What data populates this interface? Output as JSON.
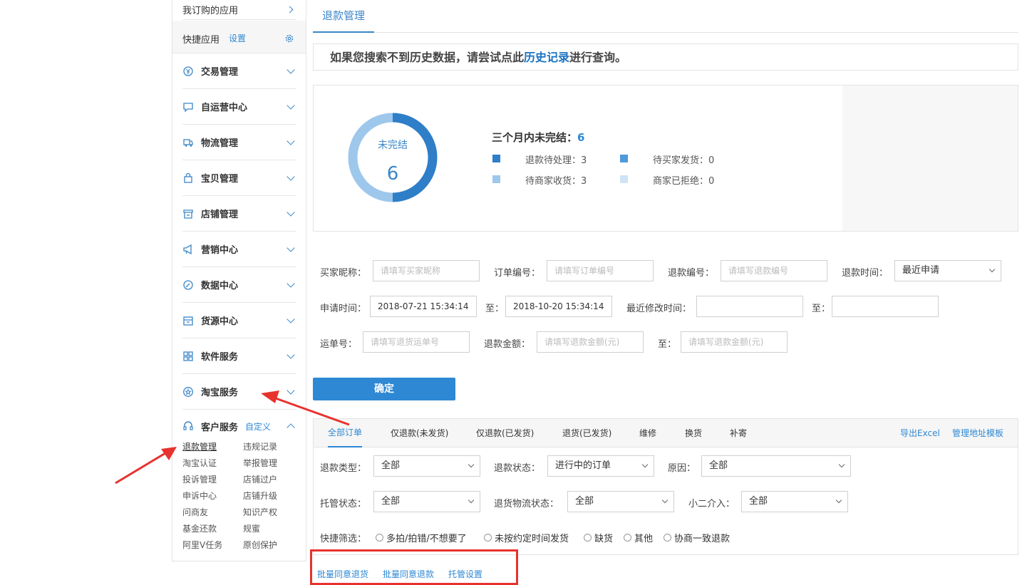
{
  "sidebar": {
    "subscribed": "我订购的应用",
    "quick_apps": "快捷应用",
    "settings": "设置",
    "menus": [
      {
        "label": "交易管理",
        "icon": "yen-icon"
      },
      {
        "label": "自运营中心",
        "icon": "chat-icon"
      },
      {
        "label": "物流管理",
        "icon": "truck-icon"
      },
      {
        "label": "宝贝管理",
        "icon": "bag-icon"
      },
      {
        "label": "店铺管理",
        "icon": "store-icon"
      },
      {
        "label": "营销中心",
        "icon": "megaphone-icon"
      },
      {
        "label": "数据中心",
        "icon": "chart-icon"
      },
      {
        "label": "货源中心",
        "icon": "box-icon"
      },
      {
        "label": "软件服务",
        "icon": "grid-icon"
      },
      {
        "label": "淘宝服务",
        "icon": "star-icon"
      }
    ],
    "customer_service": {
      "label": "客户服务",
      "customize": "自定义",
      "links": [
        [
          "退款管理",
          "违规记录"
        ],
        [
          "淘宝认证",
          "举报管理"
        ],
        [
          "投诉管理",
          "店铺过户"
        ],
        [
          "申诉中心",
          "店铺升级"
        ],
        [
          "问商友",
          "知识产权"
        ],
        [
          "基金还款",
          "规蜜"
        ],
        [
          "阿里V任务",
          "原创保护"
        ]
      ]
    }
  },
  "page": {
    "tab": "退款管理",
    "notice_pre": "如果您搜索不到历史数据，请尝试点此",
    "notice_link": "历史记录",
    "notice_post": "进行查询。"
  },
  "stats": {
    "donut_label": "未完结",
    "donut_value": "6",
    "title": "三个月内未完结：",
    "total": "6",
    "legend": [
      {
        "label": "退款待处理：3",
        "color": "#2e7ec8",
        "value": 3
      },
      {
        "label": "待买家发货：0",
        "color": "#4f9ad8",
        "value": 0
      },
      {
        "label": "待商家收货：3",
        "color": "#9ec7ec",
        "value": 3
      },
      {
        "label": "商家已拒绝：0",
        "color": "#cfe3f5",
        "value": 0
      }
    ]
  },
  "filters": {
    "buyer_nick": "买家昵称：",
    "buyer_nick_ph": "请填写买家昵称",
    "order_no": "订单编号：",
    "order_no_ph": "请填写订单编号",
    "refund_no": "退款编号：",
    "refund_no_ph": "请填写退款编号",
    "refund_time": "退款时间：",
    "refund_time_val": "最近申请",
    "apply_time": "申请时间：",
    "apply_from": "2018-07-21 15:34:14",
    "to": "至：",
    "apply_to": "2018-10-20 15:34:14",
    "modify_time": "最近修改时间：",
    "waybill": "运单号：",
    "waybill_ph": "请填写退货运单号",
    "amount": "退款金额：",
    "amount_ph": "请填写退款金额(元)",
    "confirm": "确定"
  },
  "orders": {
    "tabs": [
      "全部订单",
      "仅退款(未发货)",
      "仅退款(已发货)",
      "退货(已发货)",
      "维修",
      "换货",
      "补寄"
    ],
    "export": "导出Excel",
    "addr_tpl": "管理地址模板",
    "refund_type": "退款类型：",
    "refund_type_val": "全部",
    "refund_status": "退款状态：",
    "refund_status_val": "进行中的订单",
    "reason": "原因：",
    "reason_val": "全部",
    "custody": "托管状态：",
    "custody_val": "全部",
    "return_logistics": "退货物流状态：",
    "return_logistics_val": "全部",
    "xiaoer": "小二介入：",
    "xiaoer_val": "全部",
    "quick": "快捷筛选：",
    "quick_opts": [
      "多拍/拍错/不想要了",
      "未按约定时间发货",
      "缺货",
      "其他",
      "协商一致退款"
    ],
    "batch": [
      "批量同意退货",
      "批量同意退款",
      "托管设置"
    ]
  }
}
